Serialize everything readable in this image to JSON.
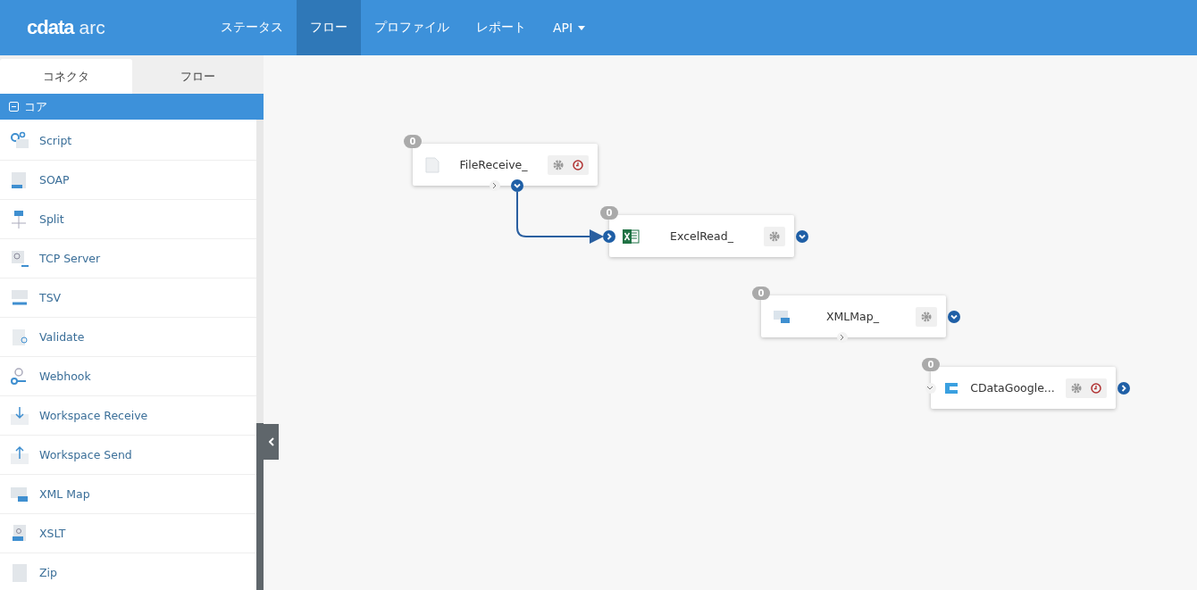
{
  "logo": {
    "brand": "cdata",
    "product": "arc"
  },
  "nav": [
    {
      "label": "ステータス",
      "selected": false
    },
    {
      "label": "フロー",
      "selected": true
    },
    {
      "label": "プロファイル",
      "selected": false
    },
    {
      "label": "レポート",
      "selected": false
    },
    {
      "label": "API",
      "selected": false,
      "dropdown": true
    }
  ],
  "sidebar": {
    "tabs": [
      {
        "label": "コネクタ",
        "selected": true
      },
      {
        "label": "フロー",
        "selected": false
      }
    ],
    "group": {
      "label": "コア",
      "expanded": true
    },
    "items": [
      {
        "label": "Script",
        "kind": "script"
      },
      {
        "label": "SOAP",
        "kind": "soap"
      },
      {
        "label": "Split",
        "kind": "split"
      },
      {
        "label": "TCP Server",
        "kind": "tcp"
      },
      {
        "label": "TSV",
        "kind": "tsv"
      },
      {
        "label": "Validate",
        "kind": "validate"
      },
      {
        "label": "Webhook",
        "kind": "webhook"
      },
      {
        "label": "Workspace Receive",
        "kind": "receive"
      },
      {
        "label": "Workspace Send",
        "kind": "send"
      },
      {
        "label": "XML Map",
        "kind": "xmlmap"
      },
      {
        "label": "XSLT",
        "kind": "xslt"
      },
      {
        "label": "Zip",
        "kind": "zip"
      }
    ]
  },
  "flow": {
    "nodes": [
      {
        "name": "FileReceive_",
        "count": "0",
        "kind": "file",
        "schedule": true,
        "ports": [
          {
            "kind": "expand"
          },
          {
            "kind": "down",
            "connected": true
          }
        ]
      },
      {
        "name": "ExcelRead_",
        "count": "0",
        "kind": "excel",
        "schedule": false,
        "ports": [
          {
            "kind": "in"
          },
          {
            "kind": "down"
          }
        ]
      },
      {
        "name": "XMLMap_",
        "count": "0",
        "kind": "xmlmap",
        "schedule": false,
        "ports": [
          {
            "kind": "down"
          },
          {
            "kind": "expand"
          }
        ]
      },
      {
        "name": "CDataGoogle...",
        "count": "0",
        "kind": "cdata",
        "schedule": true,
        "ports": [
          {
            "kind": "collapsed"
          },
          {
            "kind": "next"
          }
        ]
      }
    ]
  }
}
